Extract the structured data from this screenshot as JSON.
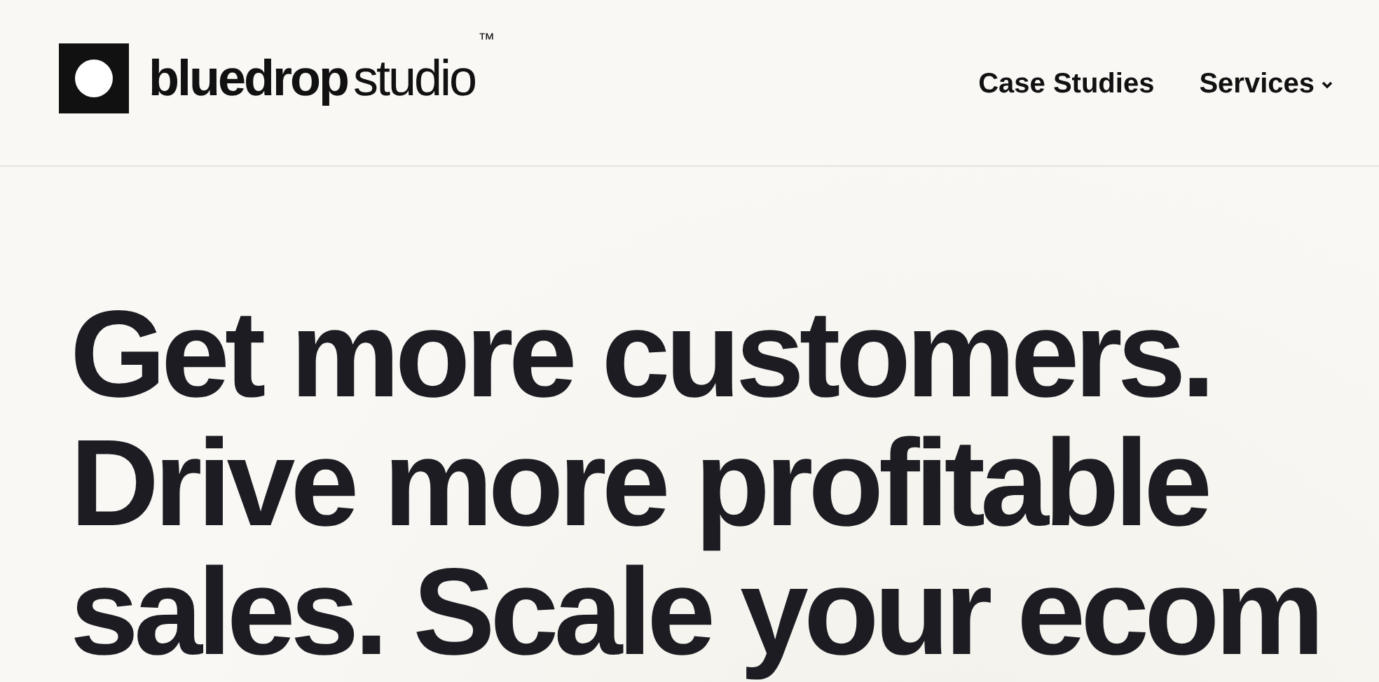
{
  "header": {
    "logo": {
      "wordmark": "**bluedrop**studio",
      "trademark": "™"
    },
    "nav": [
      {
        "label": "Case Studies",
        "dropdown": false
      },
      {
        "label": "Services",
        "dropdown": true
      }
    ]
  },
  "hero": {
    "headline_lines": [
      "Get more customers.",
      "Drive more profitable",
      "sales. Scale your ecom"
    ]
  }
}
